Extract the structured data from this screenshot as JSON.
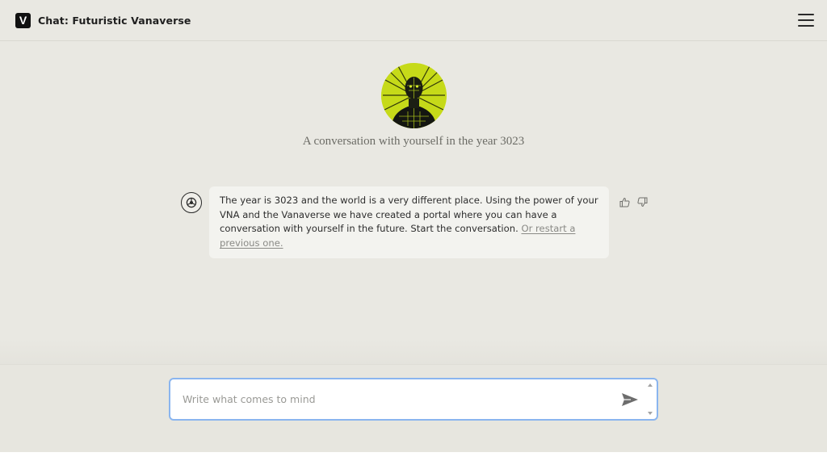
{
  "header": {
    "logo_letter": "V",
    "title": "Chat: Futuristic Vanaverse",
    "menu_icon": "hamburger-menu-icon"
  },
  "hero": {
    "avatar_icon": "robot-avatar",
    "subtitle": "A conversation with yourself in the year 3023"
  },
  "message": {
    "sender_icon": "bot-icon",
    "text": "The year is 3023 and the world is a very different place. Using the power of your VNA and the Vanaverse we have created a portal where you can have a conversation with yourself in the future. Start the conversation.",
    "restart_link": "Or restart a previous one.",
    "thumbs_up_icon": "thumbs-up-icon",
    "thumbs_down_icon": "thumbs-down-icon"
  },
  "composer": {
    "placeholder": "Write what comes to mind",
    "value": "",
    "send_icon": "send-icon"
  },
  "colors": {
    "background": "#e9e8e2",
    "bubble": "#f3f3ef",
    "input_border": "#8ab5ef",
    "avatar_accent": "#c9dc1a"
  }
}
